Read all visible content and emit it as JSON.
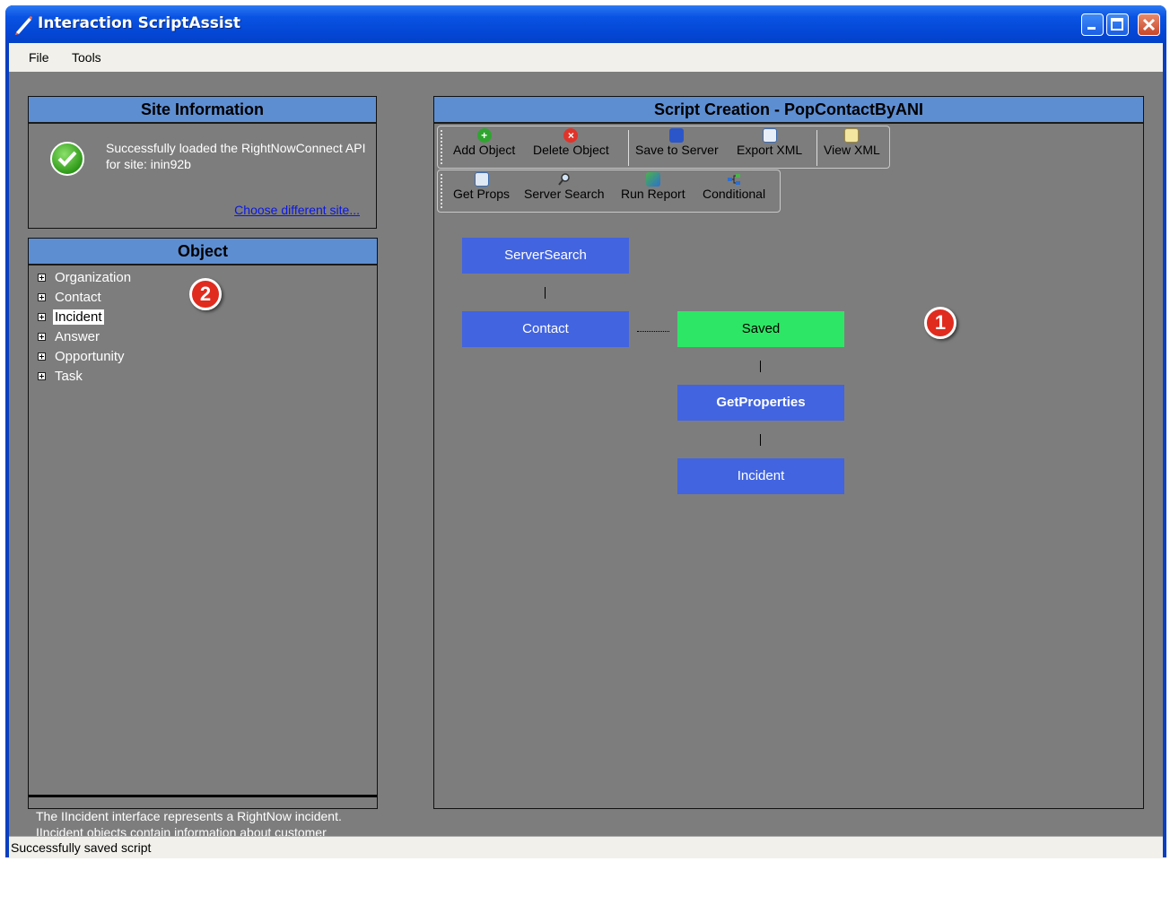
{
  "window": {
    "title": "Interaction ScriptAssist"
  },
  "menu": {
    "file": "File",
    "tools": "Tools"
  },
  "site_panel": {
    "header": "Site Information",
    "message": "Successfully loaded the RightNowConnect API for site: inin92b",
    "link": "Choose different site..."
  },
  "object_panel": {
    "header": "Object",
    "items": [
      {
        "label": "Organization"
      },
      {
        "label": "Contact"
      },
      {
        "label": "Incident",
        "selected": true
      },
      {
        "label": "Answer"
      },
      {
        "label": "Opportunity"
      },
      {
        "label": "Task"
      }
    ],
    "description": "The IIncident interface represents a RightNow incident. IIncident objects contain information about customer incidents or issues. The default visibility of all attributes unless otherwise stated is visible on create and update transactions but not required, not visible on delete transactions, and returned on get transactions."
  },
  "script_panel": {
    "header": "Script Creation - PopContactByANI",
    "toolbar_row1": {
      "add_object": "Add Object",
      "delete_object": "Delete Object",
      "save_to_server": "Save to Server",
      "export_xml": "Export XML",
      "view_xml": "View XML"
    },
    "toolbar_row2": {
      "get_props": "Get Props",
      "server_search": "Server Search",
      "run_report": "Run Report",
      "conditional": "Conditional"
    },
    "nodes": {
      "server_search": "ServerSearch",
      "contact": "Contact",
      "saved": "Saved",
      "get_properties": "GetProperties",
      "incident": "Incident"
    }
  },
  "badges": {
    "one": "1",
    "two": "2"
  },
  "status": {
    "text": "Successfully saved script"
  },
  "colors": {
    "title_bar": "#0a54e3",
    "panel_header": "#5e8ed2",
    "panel_bg": "#7d7d7d",
    "node_blue": "#4264e0",
    "node_green": "#2ee665",
    "badge_red": "#e02b1f"
  },
  "icons": {
    "app": "pen-icon",
    "add": "add-icon",
    "delete": "delete-icon",
    "save": "disk-icon",
    "export": "export-icon",
    "view": "view-xml-icon",
    "get_props": "properties-icon",
    "server_search": "search-icon",
    "run_report": "report-icon",
    "conditional": "branch-icon",
    "success": "check-icon"
  }
}
